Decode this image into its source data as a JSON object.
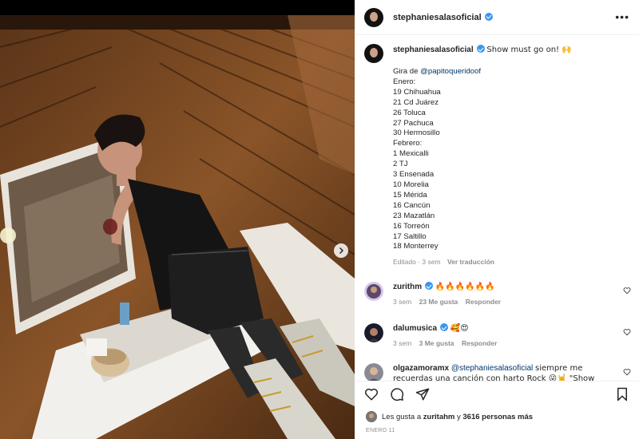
{
  "post": {
    "username": "stephaniesalasoficial",
    "more_icon": "more-horizontal-icon",
    "caption_head": "Show must go on! 🙌",
    "caption_lines": [
      "Gira de",
      "Enero:",
      "19 Chihuahua",
      "21 Cd Juárez",
      "26 Toluca",
      "27 Pachuca",
      "30 Hermosillo",
      "Febrero:",
      "1 Mexicalli",
      "2 TJ",
      "3 Ensenada",
      "10 Morelia",
      "15 Mérida",
      "16 Cancún",
      "23 Mazatlán",
      "16 Torreón",
      "17 Saltillo",
      "18 Monterrey"
    ],
    "mention": "@papitoqueridoof",
    "edited": "Editado",
    "age": "3 sem",
    "translate": "Ver traducción"
  },
  "comments": [
    {
      "username": "zurithm",
      "text": "🔥🔥🔥🔥🔥🔥",
      "age": "3 sem",
      "likes": "23 Me gusta",
      "reply": "Responder"
    },
    {
      "username": "dalumusica",
      "text": "🥰😍",
      "age": "3 sem",
      "likes": "3 Me gusta",
      "reply": "Responder"
    },
    {
      "username": "olgazamoramx",
      "mention": "@stephaniesalasoficial",
      "text": "siempre me recuerdas una canción con harto Rock 😜🤘 \"Show must go on\" Queen",
      "text_tail": "👏👏👏👏👏"
    }
  ],
  "actions": {
    "icons": [
      "heart-icon",
      "comment-icon",
      "share-icon",
      "bookmark-icon"
    ]
  },
  "likes": {
    "prefix": "Les gusta a",
    "user": "zuritahm",
    "conj": "y",
    "count": "3616 personas más"
  },
  "date": "ENERO 11",
  "colors": {
    "verified": "#3897f0",
    "link": "#00376b",
    "muted": "#8e8e8e",
    "text": "#262626"
  }
}
